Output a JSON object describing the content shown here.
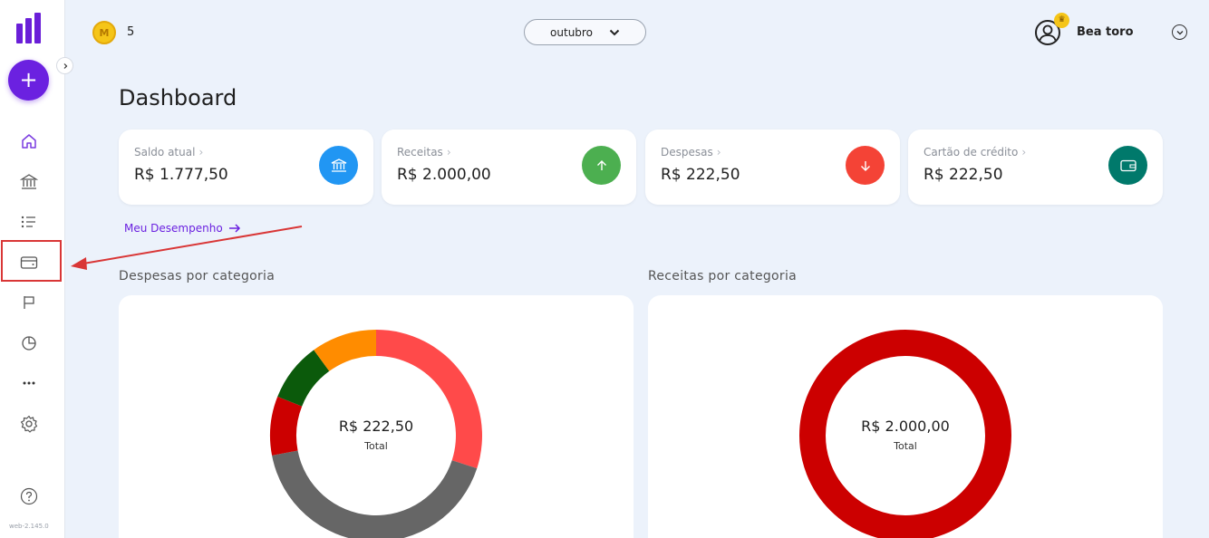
{
  "sidebar": {
    "items": [
      {
        "name": "home-icon",
        "label": "Início"
      },
      {
        "name": "bank-icon",
        "label": "Contas"
      },
      {
        "name": "list-icon",
        "label": "Transações"
      },
      {
        "name": "wallet-icon",
        "label": "Cartões"
      },
      {
        "name": "flag-icon",
        "label": "Objetivos"
      },
      {
        "name": "pie-chart-icon",
        "label": "Relatórios"
      },
      {
        "name": "more-icon",
        "label": "Mais"
      },
      {
        "name": "gear-icon",
        "label": "Configurações"
      },
      {
        "name": "help-icon",
        "label": "Ajuda"
      }
    ],
    "version": "web-2.145.0"
  },
  "header": {
    "coins": "5",
    "month": "outubro",
    "user_name": "Bea toro"
  },
  "page_title": "Dashboard",
  "cards": [
    {
      "label": "Saldo atual",
      "value": "R$ 1.777,50",
      "color": "#2196f3",
      "icon": "bank-icon"
    },
    {
      "label": "Receitas",
      "value": "R$ 2.000,00",
      "color": "#4caf50",
      "icon": "arrow-up-icon"
    },
    {
      "label": "Despesas",
      "value": "R$ 222,50",
      "color": "#f44336",
      "icon": "arrow-down-icon"
    },
    {
      "label": "Cartão de crédito",
      "value": "R$ 222,50",
      "color": "#00796b",
      "icon": "wallet-icon"
    }
  ],
  "performance_link": "Meu Desempenho",
  "sections": {
    "expenses_title": "Despesas por categoria",
    "income_title": "Receitas por categoria"
  },
  "chart_data": [
    {
      "type": "pie",
      "title": "Despesas por categoria",
      "center_value": "R$ 222,50",
      "center_label": "Total",
      "slices": [
        {
          "color": "#ff4a4a",
          "fraction": 0.3
        },
        {
          "color": "#666666",
          "fraction": 0.42
        },
        {
          "color": "#cc0000",
          "fraction": 0.09
        },
        {
          "color": "#0b5a0b",
          "fraction": 0.09
        },
        {
          "color": "#ff8c00",
          "fraction": 0.1
        }
      ]
    },
    {
      "type": "pie",
      "title": "Receitas por categoria",
      "center_value": "R$ 2.000,00",
      "center_label": "Total",
      "slices": [
        {
          "color": "#cc0000",
          "fraction": 1.0
        }
      ]
    }
  ]
}
